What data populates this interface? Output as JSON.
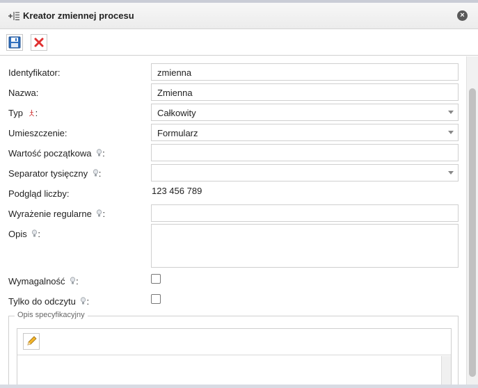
{
  "window": {
    "title": "Kreator zmiennej procesu",
    "title_icon": "add-variable-icon",
    "close_icon": "close-icon"
  },
  "toolbar": {
    "save_icon": "save-icon",
    "cancel_icon": "cancel-icon"
  },
  "form": {
    "identifier_label": "Identyfikator:",
    "identifier_value": "zmienna",
    "name_label": "Nazwa:",
    "name_value": "Zmienna",
    "type_label": "Typ",
    "type_suffix": ":",
    "type_value": "Całkowity",
    "placement_label": "Umieszczenie:",
    "placement_value": "Formularz",
    "initial_value_label": "Wartość początkowa",
    "initial_value_suffix": ":",
    "initial_value": "",
    "thousands_sep_label": "Separator tysięczny",
    "thousands_sep_suffix": ":",
    "thousands_sep_value": "",
    "preview_label": "Podgląd liczby:",
    "preview_value": "123 456 789",
    "regex_label": "Wyrażenie regularne",
    "regex_suffix": ":",
    "regex_value": "",
    "description_label": "Opis",
    "description_suffix": ":",
    "required_label": "Wymagalność",
    "required_suffix": ":",
    "readonly_label": "Tylko do odczytu",
    "readonly_suffix": ":"
  },
  "spec": {
    "legend": "Opis specyfikacyjny",
    "edit_icon": "pencil-icon"
  },
  "colors": {
    "required_marker": "#d23c3c",
    "hint_icon": "#9aa0a6"
  }
}
